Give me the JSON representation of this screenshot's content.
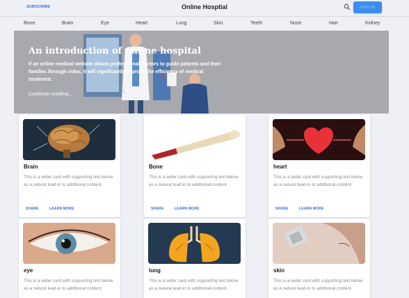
{
  "header": {
    "subscribe_label": "SUBSCRIBE",
    "title": "Online Hosptial",
    "search_icon": "search-icon",
    "signup_label": "SIGN UP"
  },
  "nav": [
    "Bone",
    "Brain",
    "Eye",
    "Heart",
    "Lung",
    "Skin",
    "Teeth",
    "Nose",
    "Hair",
    "Kidney"
  ],
  "hero": {
    "title": "An introduction of online hospital",
    "text": "If an online medical website allows professional doctors to guide patients and their families through video, it will significantly improve the efficiency of medical treatment.",
    "link_label": "Continue reading..."
  },
  "cards": [
    {
      "title": "Brain",
      "text": "This is a wider card with supporting text below as a natural lead-in to additional content.",
      "share": "SHARE",
      "learn": "LEARN MORE"
    },
    {
      "title": "Bone",
      "text": "This is a wider card with supporting text below as a natural lead-in to additional content.",
      "share": "SHARE",
      "learn": "LEARN MORE"
    },
    {
      "title": "heart",
      "text": "This is a wider card with supporting text below as a natural lead-in to additional content.",
      "share": "SHARE",
      "learn": "LEARN MORE"
    },
    {
      "title": "eye",
      "text": "This is a wider card with supporting text below as a natural lead-in to additional content."
    },
    {
      "title": "lung",
      "text": "This is a wider card with supporting text below as a natural lead-in to additional content."
    },
    {
      "title": "skin",
      "text": "This is a wider card with supporting text below as a natural lead-in to additional content."
    }
  ],
  "colors": {
    "accent": "#2f6bd8",
    "signup_bg": "#3d8cf1",
    "page_bg": "#eef0f5"
  }
}
